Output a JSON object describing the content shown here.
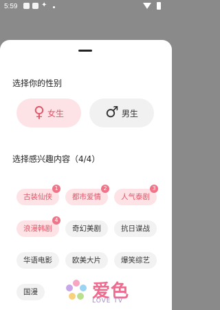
{
  "status_bar": {
    "time": "5:59",
    "icons": [
      "notification-icon",
      "sim-icon",
      "bug-icon",
      "dot-icon",
      "wifi-icon",
      "battery-icon"
    ]
  },
  "sheet": {
    "gender_title": "选择你的性别",
    "gender_options": [
      {
        "label": "女生",
        "icon": "female-icon",
        "symbol": "♀",
        "selected": true
      },
      {
        "label": "男生",
        "icon": "male-icon",
        "symbol": "♂",
        "selected": false
      }
    ],
    "interest_title": "选择感兴趣内容（4/4）",
    "interests": [
      {
        "label": "古装仙侠",
        "selected": true,
        "order": "1"
      },
      {
        "label": "都市爱情",
        "selected": true,
        "order": "2"
      },
      {
        "label": "人气泰剧",
        "selected": true,
        "order": "3"
      },
      {
        "label": "浪漫韩剧",
        "selected": true,
        "order": "4"
      },
      {
        "label": "奇幻美剧",
        "selected": false
      },
      {
        "label": "抗日谍战",
        "selected": false
      },
      {
        "label": "华语电影",
        "selected": false
      },
      {
        "label": "欧美大片",
        "selected": false
      },
      {
        "label": "爆笑综艺",
        "selected": false
      },
      {
        "label": "国漫",
        "selected": false
      }
    ]
  },
  "watermark": {
    "title": "爱色",
    "subtitle": "LOVE TV",
    "icon": "flower-logo-icon"
  },
  "colors": {
    "accent": "#e25568",
    "selected_bg": "#fde3e6",
    "badge": "#f07387",
    "tag_bg": "#f2f2f2"
  }
}
